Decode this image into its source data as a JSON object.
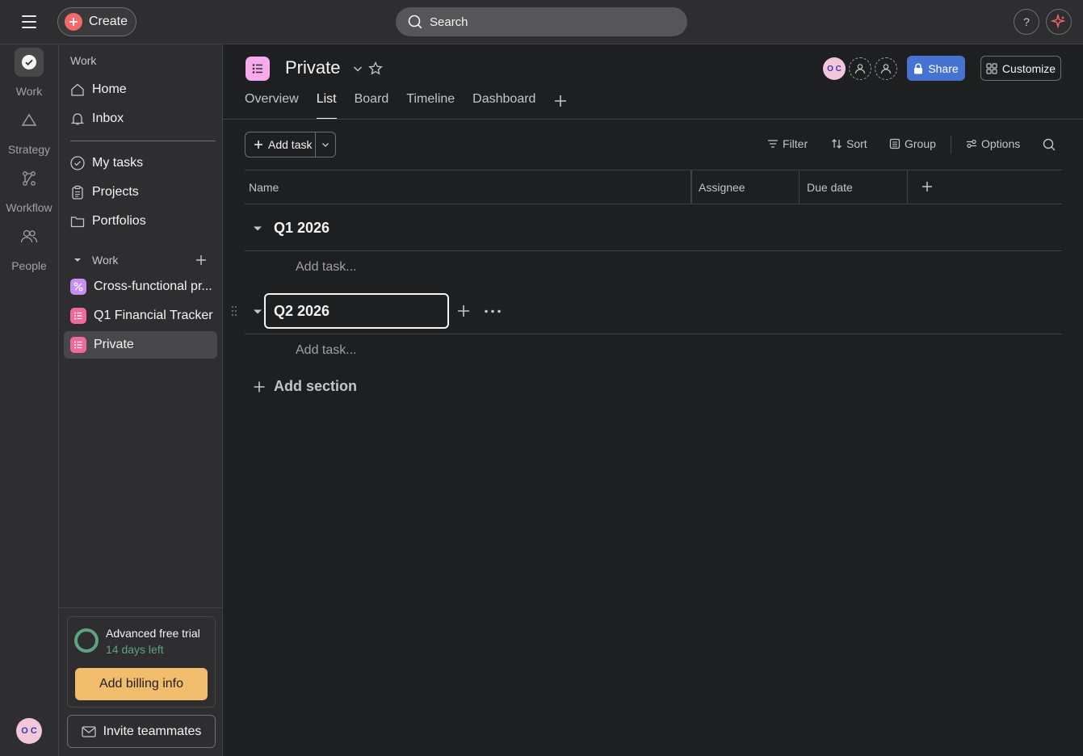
{
  "topbar": {
    "create_label": "Create",
    "search_placeholder": "Search",
    "help_label": "?"
  },
  "rail": {
    "items": [
      {
        "label": "Work",
        "icon": "check-circle-icon"
      },
      {
        "label": "Strategy",
        "icon": "triangle-icon"
      },
      {
        "label": "Workflow",
        "icon": "workflow-icon"
      },
      {
        "label": "People",
        "icon": "people-icon"
      }
    ],
    "avatar_initials": "O C"
  },
  "sidebar": {
    "section_title": "Work",
    "nav": [
      {
        "label": "Home",
        "icon": "home-icon"
      },
      {
        "label": "Inbox",
        "icon": "bell-icon"
      }
    ],
    "nav2": [
      {
        "label": "My tasks",
        "icon": "check-circle-icon"
      },
      {
        "label": "Projects",
        "icon": "clipboard-icon"
      },
      {
        "label": "Portfolios",
        "icon": "folder-icon"
      }
    ],
    "work_group_label": "Work",
    "projects": [
      {
        "label": "Cross-functional pr...",
        "color": "#c78ef3"
      },
      {
        "label": "Q1 Financial Tracker",
        "color": "#f06a99"
      },
      {
        "label": "Private",
        "color": "#f06a99"
      }
    ],
    "trial": {
      "title": "Advanced free trial",
      "days_left": "14 days left",
      "billing_button": "Add billing info"
    },
    "invite_button": "Invite teammates"
  },
  "project": {
    "title": "Private",
    "icon_color": "#f9aaef",
    "avatar_initials": "O C",
    "share_label": "Share",
    "customize_label": "Customize",
    "tabs": [
      {
        "label": "Overview",
        "active": false
      },
      {
        "label": "List",
        "active": true
      },
      {
        "label": "Board",
        "active": false
      },
      {
        "label": "Timeline",
        "active": false
      },
      {
        "label": "Dashboard",
        "active": false
      }
    ]
  },
  "toolbar": {
    "add_task_label": "Add task",
    "filter_label": "Filter",
    "sort_label": "Sort",
    "group_label": "Group",
    "options_label": "Options"
  },
  "table": {
    "columns": [
      "Name",
      "Assignee",
      "Due date"
    ],
    "sections": [
      {
        "title": "Q1 2026",
        "add_task_placeholder": "Add task..."
      },
      {
        "title": "Q2 2026",
        "add_task_placeholder": "Add task..."
      }
    ],
    "add_section_label": "Add section"
  },
  "colors": {
    "accent_blue": "#4573d2",
    "create_red": "#f06a6a",
    "trial_green": "#5da283",
    "billing_orange": "#f1bd6c"
  }
}
